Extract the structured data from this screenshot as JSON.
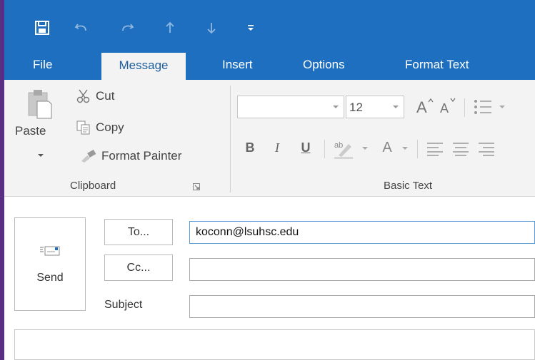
{
  "quick_access": {
    "icons": [
      "save-icon",
      "undo-icon",
      "redo-icon",
      "previous-item-icon",
      "next-item-icon",
      "customize-qat-icon"
    ]
  },
  "tabs": [
    {
      "label": "File"
    },
    {
      "label": "Message"
    },
    {
      "label": "Insert"
    },
    {
      "label": "Options"
    },
    {
      "label": "Format Text"
    }
  ],
  "ribbon": {
    "clipboard": {
      "paste": "Paste",
      "cut": "Cut",
      "copy": "Copy",
      "format_painter": "Format Painter",
      "group_label": "Clipboard"
    },
    "basic_text": {
      "font_size": "12",
      "bold": "B",
      "italic": "I",
      "underline": "U",
      "font_color": "A",
      "group_label": "Basic Text"
    }
  },
  "compose": {
    "send": "Send",
    "to_button": "To...",
    "cc_button": "Cc...",
    "subject_label": "Subject",
    "to_value": "koconn@lsuhsc.edu",
    "cc_value": "",
    "subject_value": ""
  },
  "colors": {
    "title_bar": "#1e6fbf",
    "window_border": "#5b2e86",
    "ribbon_bg": "#f3f3f3",
    "active_tab_text": "#1e5fa0"
  }
}
